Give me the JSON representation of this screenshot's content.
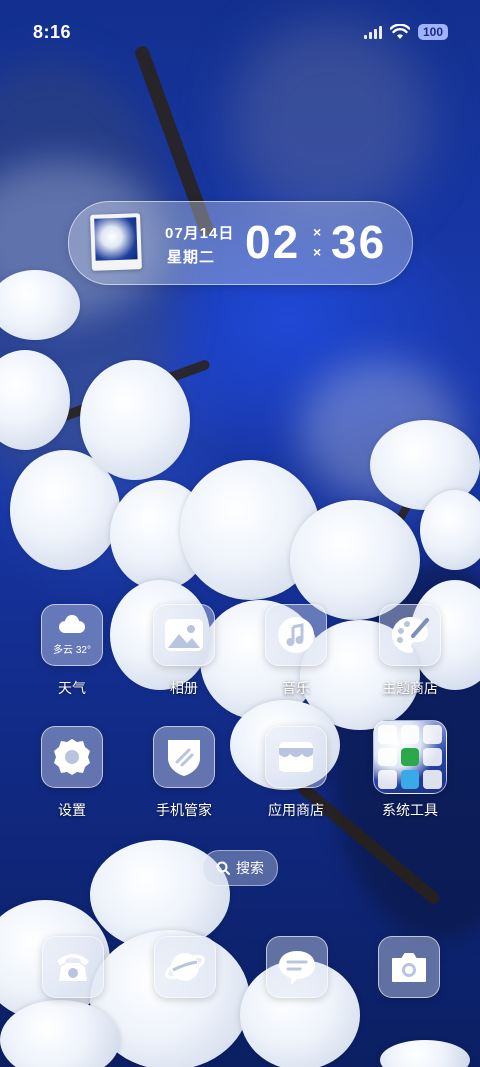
{
  "status_bar": {
    "time": "8:16",
    "battery": "100"
  },
  "widget": {
    "date": "07月14日",
    "weekday": "星期二",
    "hours": "02",
    "minutes": "36"
  },
  "apps": [
    {
      "id": "weather",
      "label": "天气",
      "icon": "weather-icon",
      "detail": "多云 32°"
    },
    {
      "id": "gallery",
      "label": "相册",
      "icon": "gallery-icon"
    },
    {
      "id": "music",
      "label": "音乐",
      "icon": "music-icon"
    },
    {
      "id": "themes",
      "label": "主题商店",
      "icon": "palette-icon"
    },
    {
      "id": "settings",
      "label": "设置",
      "icon": "gear-icon"
    },
    {
      "id": "security",
      "label": "手机管家",
      "icon": "shield-icon"
    },
    {
      "id": "appstore",
      "label": "应用商店",
      "icon": "store-icon"
    },
    {
      "id": "tools",
      "label": "系统工具",
      "icon": "folder-icon"
    }
  ],
  "search": {
    "label": "搜索"
  },
  "dock": [
    {
      "id": "phone",
      "icon": "phone-icon"
    },
    {
      "id": "browser",
      "icon": "browser-icon"
    },
    {
      "id": "messages",
      "icon": "message-icon"
    },
    {
      "id": "camera",
      "icon": "camera-icon"
    }
  ],
  "colors": {
    "sky": "#1a3ab0",
    "glass": "#cdd7eb"
  }
}
